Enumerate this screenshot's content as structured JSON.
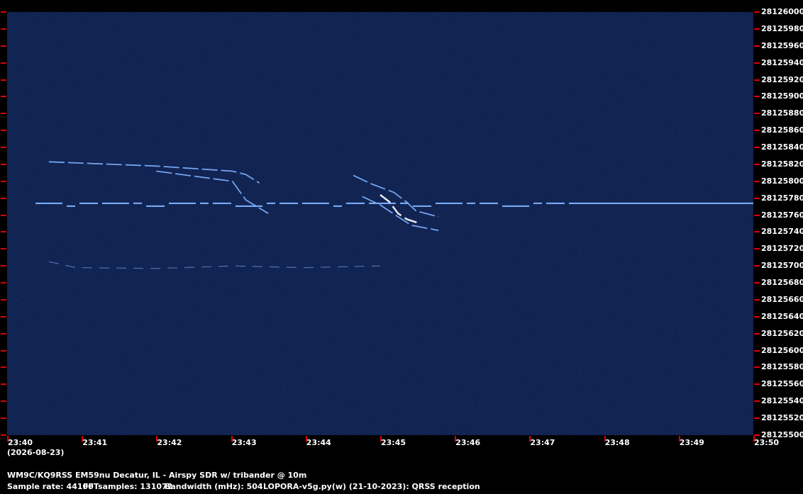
{
  "chart_data": {
    "type": "heatmap",
    "title": "",
    "colors": {
      "background": "#0b1d4a",
      "signal": "#7fb3ff",
      "signal_bright": "#ffffff",
      "tick": "#e00000",
      "text": "#ffffff"
    },
    "y_axis": {
      "unit": "Hz",
      "min": 28125500,
      "max": 28126000,
      "step": 20,
      "tick_labels": [
        "28126000",
        "28125980",
        "28125960",
        "28125940",
        "28125920",
        "28125900",
        "28125880",
        "28125860",
        "28125840",
        "28125820",
        "28125800",
        "28125780",
        "28125760",
        "28125740",
        "28125720",
        "28125700",
        "28125680",
        "28125660",
        "28125640",
        "28125620",
        "28125600",
        "28125580",
        "28125560",
        "28125540",
        "28125520",
        "28125500"
      ]
    },
    "x_axis": {
      "unit": "UTC time",
      "tick_labels": [
        "23:40",
        "23:41",
        "23:42",
        "23:43",
        "23:44",
        "23:45",
        "23:46",
        "23:47",
        "23:48",
        "23:49",
        "23:50"
      ],
      "date": "(2026-08-23)"
    },
    "signals": [
      {
        "name": "",
        "description": "dashed carrier",
        "freq": 28125774,
        "t_start": 23.667,
        "t_end": 23.833
      },
      {
        "description": "faint trace",
        "points": [
          [
            23.676,
            28125705
          ],
          [
            23.682,
            28125698
          ],
          [
            23.7,
            28125697
          ],
          [
            23.717,
            28125700
          ],
          [
            23.733,
            28125698
          ],
          [
            23.75,
            28125700
          ]
        ]
      },
      {
        "description": "descending trace 1 (upper)",
        "points": [
          [
            23.676,
            28125823
          ],
          [
            23.7,
            28125818
          ],
          [
            23.717,
            28125812
          ],
          [
            23.72,
            28125808
          ],
          [
            23.723,
            28125798
          ]
        ]
      },
      {
        "description": "descending trace 1 (lower)",
        "points": [
          [
            23.7,
            28125812
          ],
          [
            23.717,
            28125800
          ],
          [
            23.72,
            28125778
          ],
          [
            23.725,
            28125762
          ]
        ]
      },
      {
        "description": "descending trace 2 (upper)",
        "points": [
          [
            23.744,
            28125807
          ],
          [
            23.748,
            28125797
          ],
          [
            23.753,
            28125787
          ],
          [
            23.756,
            28125775
          ],
          [
            23.758,
            28125765
          ],
          [
            23.763,
            28125758
          ]
        ]
      },
      {
        "description": "descending trace 2 (lower)",
        "points": [
          [
            23.746,
            28125782
          ],
          [
            23.75,
            28125772
          ],
          [
            23.754,
            28125758
          ],
          [
            23.757,
            28125748
          ],
          [
            23.763,
            28125742
          ]
        ]
      },
      {
        "description": "descending trace 2 (bright)",
        "points": [
          [
            23.75,
            28125784
          ],
          [
            23.752,
            28125776
          ],
          [
            23.754,
            28125762
          ],
          [
            23.756,
            28125755
          ],
          [
            23.759,
            28125750
          ]
        ]
      }
    ]
  },
  "footer": {
    "title": "WM9C/KQ9RSS EM59nu Decatur, IL - Airspy SDR w/ tribander @ 10m",
    "sample_rate": "Sample rate: 44100",
    "fft_samples": "FFTsamples: 131072",
    "bandwidth": "Bandwidth (mHz): 504",
    "software": "LOPORA-v5g.py(w) (21-10-2023): QRSS reception"
  }
}
